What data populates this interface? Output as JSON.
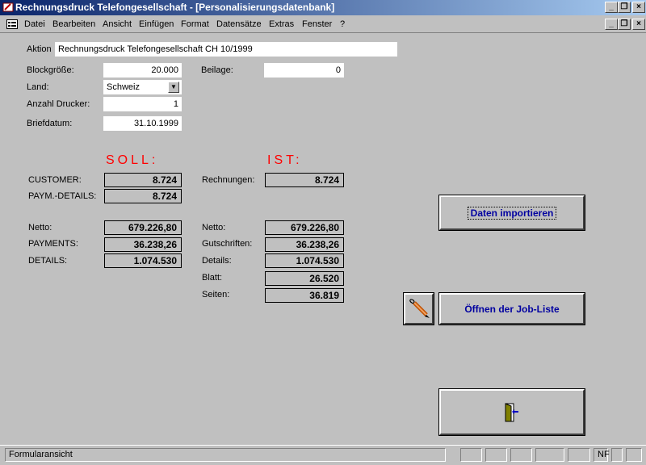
{
  "window": {
    "title": "Rechnungsdruck Telefongesellschaft - [Personalisierungsdatenbank]"
  },
  "menu": [
    "Datei",
    "Bearbeiten",
    "Ansicht",
    "Einfügen",
    "Format",
    "Datensätze",
    "Extras",
    "Fenster",
    "?"
  ],
  "form": {
    "aktion_label": "Aktion",
    "aktion_value": "Rechnungsdruck Telefongesellschaft CH 10/1999",
    "blockgroesse_label": "Blockgröße:",
    "blockgroesse_value": "20.000",
    "beilage_label": "Beilage:",
    "beilage_value": "0",
    "land_label": "Land:",
    "land_value": "Schweiz",
    "anzahl_drucker_label": "Anzahl Drucker:",
    "anzahl_drucker_value": "1",
    "briefdatum_label": "Briefdatum:",
    "briefdatum_value": "31.10.1999"
  },
  "soll": {
    "heading": "SOLL:",
    "customer_label": "CUSTOMER:",
    "customer_value": "8.724",
    "paym_label": "PAYM.-DETAILS:",
    "paym_value": "8.724",
    "netto_label": "Netto:",
    "netto_value": "679.226,80",
    "payments_label": "PAYMENTS:",
    "payments_value": "36.238,26",
    "details_label": "DETAILS:",
    "details_value": "1.074.530"
  },
  "ist": {
    "heading": "IST:",
    "rechnungen_label": "Rechnungen:",
    "rechnungen_value": "8.724",
    "netto_label": "Netto:",
    "netto_value": "679.226,80",
    "gutschriften_label": "Gutschriften:",
    "gutschriften_value": "36.238,26",
    "details_label": "Details:",
    "details_value": "1.074.530",
    "blatt_label": "Blatt:",
    "blatt_value": "26.520",
    "seiten_label": "Seiten:",
    "seiten_value": "36.819"
  },
  "buttons": {
    "import_label": "Daten importieren",
    "joblist_label": "Öffnen der Job-Liste",
    "joblist_icon": "pencil-icon",
    "exit_icon": "exit-door-icon"
  },
  "status": {
    "text": "Formularansicht",
    "nf": "NF"
  }
}
